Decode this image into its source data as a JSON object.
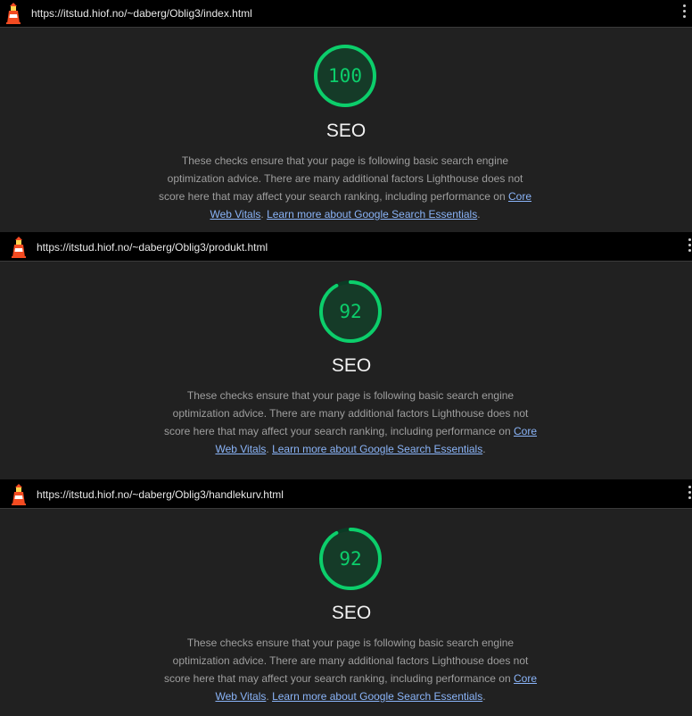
{
  "colors": {
    "pass": "#0cce6b",
    "gauge_track": "#0b3b25",
    "link": "#8ab4f8",
    "panel_bg": "#212121"
  },
  "icons": {
    "lighthouse": "lighthouse-logo-icon",
    "menu": "more-vert-icon"
  },
  "reports": [
    {
      "url": "https://itstud.hiof.no/~daberg/Oblig3/index.html",
      "score": "100",
      "score_fraction": 1.0,
      "category": "SEO",
      "description_text": "These checks ensure that your page is following basic search engine optimization advice. There are many additional factors Lighthouse does not score here that may affect your search ranking, including performance on",
      "link1": "Core Web Vitals",
      "separator": ".",
      "link2": "Learn more about Google Search Essentials",
      "end": "."
    },
    {
      "url": "https://itstud.hiof.no/~daberg/Oblig3/produkt.html",
      "score": "92",
      "score_fraction": 0.92,
      "category": "SEO",
      "description_text": "These checks ensure that your page is following basic search engine optimization advice. There are many additional factors Lighthouse does not score here that may affect your search ranking, including performance on",
      "link1": "Core Web Vitals",
      "separator": ".",
      "link2": "Learn more about Google Search Essentials",
      "end": "."
    },
    {
      "url": "https://itstud.hiof.no/~daberg/Oblig3/handlekurv.html",
      "score": "92",
      "score_fraction": 0.92,
      "category": "SEO",
      "description_text": "These checks ensure that your page is following basic search engine optimization advice. There are many additional factors Lighthouse does not score here that may affect your search ranking, including performance on",
      "link1": "Core Web Vitals",
      "separator": ".",
      "link2": "Learn more about Google Search Essentials",
      "end": "."
    }
  ]
}
